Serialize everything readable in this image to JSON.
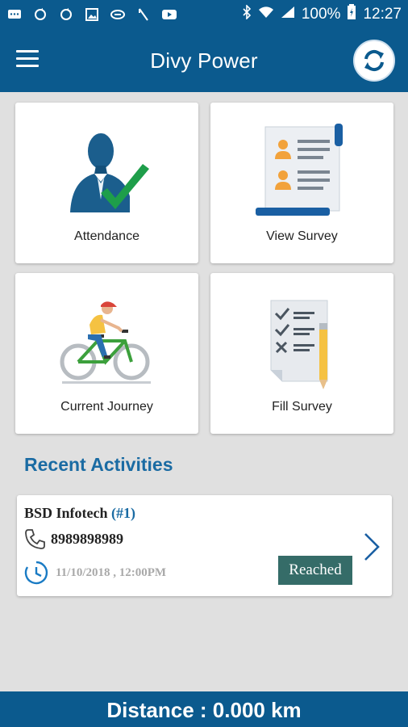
{
  "status_bar": {
    "battery": "100%",
    "time": "12:27"
  },
  "app_bar": {
    "title": "Divy Power"
  },
  "tiles": {
    "attendance": "Attendance",
    "view_survey": "View Survey",
    "current_journey": "Current Journey",
    "fill_survey": "Fill Survey"
  },
  "recent": {
    "title": "Recent Activities",
    "items": [
      {
        "name": "BSD Infotech",
        "number": "(#1)",
        "phone": "8989898989",
        "datetime": "11/10/2018 , 12:00PM",
        "status": "Reached"
      }
    ]
  },
  "footer": {
    "distance": "Distance : 0.000 km"
  },
  "colors": {
    "primary": "#0b5a8e",
    "accent_text": "#1a6ba3",
    "badge": "#356c68",
    "check_green": "#1e9e4a"
  }
}
